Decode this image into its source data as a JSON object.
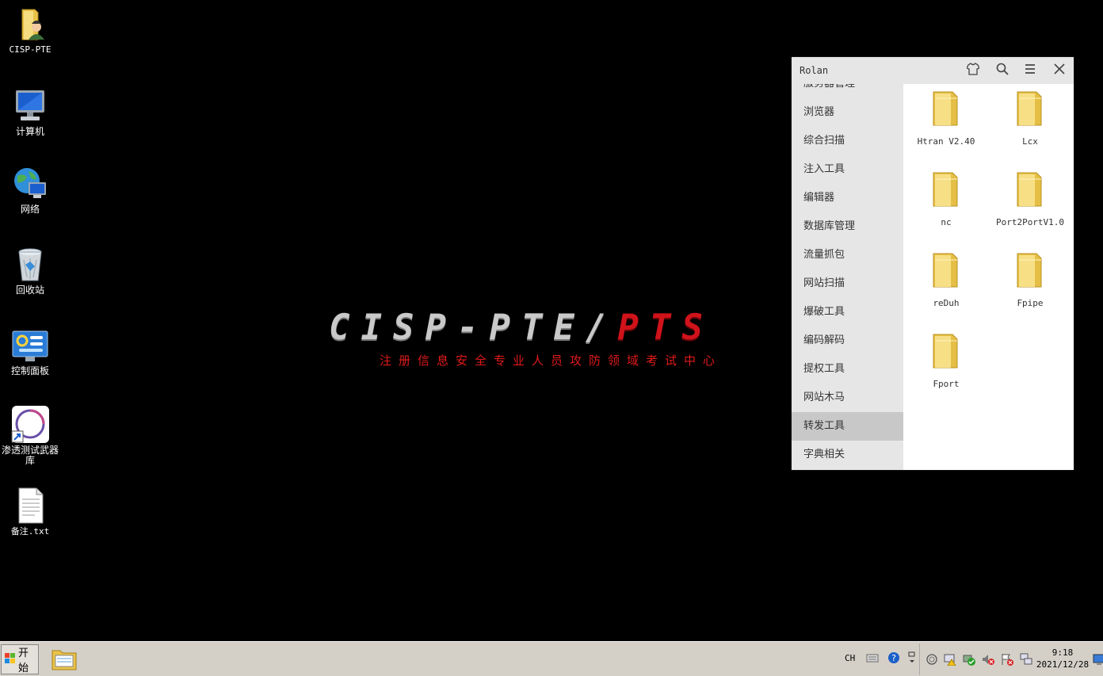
{
  "desktop": {
    "icons": [
      {
        "label": "CISP-PTE",
        "icon": "user-folder-icon"
      },
      {
        "label": "计算机",
        "icon": "computer-icon"
      },
      {
        "label": "网络",
        "icon": "network-icon"
      },
      {
        "label": "回收站",
        "icon": "recycle-bin-icon"
      },
      {
        "label": "控制面板",
        "icon": "control-panel-icon"
      },
      {
        "label": "渗透测试武器库",
        "icon": "arsenal-shortcut-icon"
      },
      {
        "label": "备注.txt",
        "icon": "text-file-icon"
      }
    ]
  },
  "banner": {
    "title_silver": "CISP-PTE/",
    "title_red": "PTS",
    "subtitle": "注册信息安全专业人员攻防领域考试中心"
  },
  "rolan": {
    "title": "Rolan",
    "categories": [
      "服务器管理",
      "浏览器",
      "综合扫描",
      "注入工具",
      "编辑器",
      "数据库管理",
      "流量抓包",
      "网站扫描",
      "爆破工具",
      "编码解码",
      "提权工具",
      "网站木马",
      "转发工具",
      "字典相关"
    ],
    "active_category": "转发工具",
    "items": [
      "Htran V2.40",
      "Lcx",
      "nc",
      "Port2PortV1.0",
      "reDuh",
      "Fpipe",
      "Fport"
    ]
  },
  "taskbar": {
    "start_label": "开始",
    "lang": "CH",
    "time": "9:18",
    "date": "2021/12/28"
  },
  "colors": {
    "banner_red": "#d0121a",
    "subtitle_red": "#e01a1a",
    "sidebar_bg": "#e6e6e6",
    "active_bg": "#c8c8c8"
  }
}
